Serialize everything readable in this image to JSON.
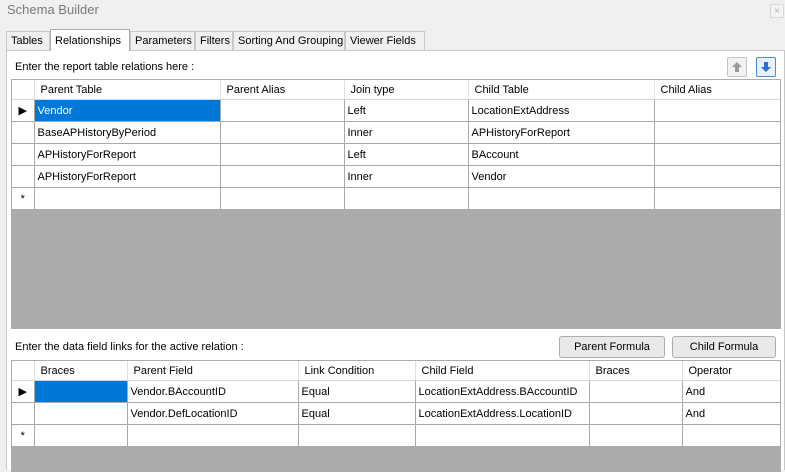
{
  "window": {
    "title": "Schema Builder",
    "close_glyph": "×"
  },
  "tabs": [
    {
      "label": "Tables"
    },
    {
      "label": "Relationships"
    },
    {
      "label": "Parameters"
    },
    {
      "label": "Filters"
    },
    {
      "label": "Sorting And Grouping"
    },
    {
      "label": "Viewer Fields"
    }
  ],
  "active_tab": "Relationships",
  "relations": {
    "label": "Enter the report table relations here :",
    "move_up_icon": "arrow-up-icon",
    "move_down_icon": "arrow-down-icon",
    "columns": [
      "Parent Table",
      "Parent Alias",
      "Join type",
      "Child Table",
      "Child Alias"
    ],
    "rows": [
      {
        "parent_table": "Vendor",
        "parent_alias": "",
        "join_type": "Left",
        "child_table": "LocationExtAddress",
        "child_alias": ""
      },
      {
        "parent_table": "BaseAPHistoryByPeriod",
        "parent_alias": "",
        "join_type": "Inner",
        "child_table": "APHistoryForReport",
        "child_alias": ""
      },
      {
        "parent_table": "APHistoryForReport",
        "parent_alias": "",
        "join_type": "Left",
        "child_table": "BAccount",
        "child_alias": ""
      },
      {
        "parent_table": "APHistoryForReport",
        "parent_alias": "",
        "join_type": "Inner",
        "child_table": "Vendor",
        "child_alias": ""
      }
    ],
    "current_row_glyph": "▶",
    "new_row_glyph": "*"
  },
  "links": {
    "label": "Enter the data field links for the active relation :",
    "parent_formula_label": "Parent Formula",
    "child_formula_label": "Child Formula",
    "columns": [
      "Braces",
      "Parent Field",
      "Link Condition",
      "Child Field",
      "Braces",
      "Operator"
    ],
    "rows": [
      {
        "braces_open": "",
        "parent_field": "Vendor.BAccountID",
        "link_condition": "Equal",
        "child_field": "LocationExtAddress.BAccountID",
        "braces_close": "",
        "operator": "And"
      },
      {
        "braces_open": "",
        "parent_field": "Vendor.DefLocationID",
        "link_condition": "Equal",
        "child_field": "LocationExtAddress.LocationID",
        "braces_close": "",
        "operator": "And"
      }
    ],
    "current_row_glyph": "▶",
    "new_row_glyph": "*"
  },
  "colors": {
    "selection": "#0078d7",
    "grid_background": "#ababab",
    "accent_blue": "#2a6fd6"
  }
}
